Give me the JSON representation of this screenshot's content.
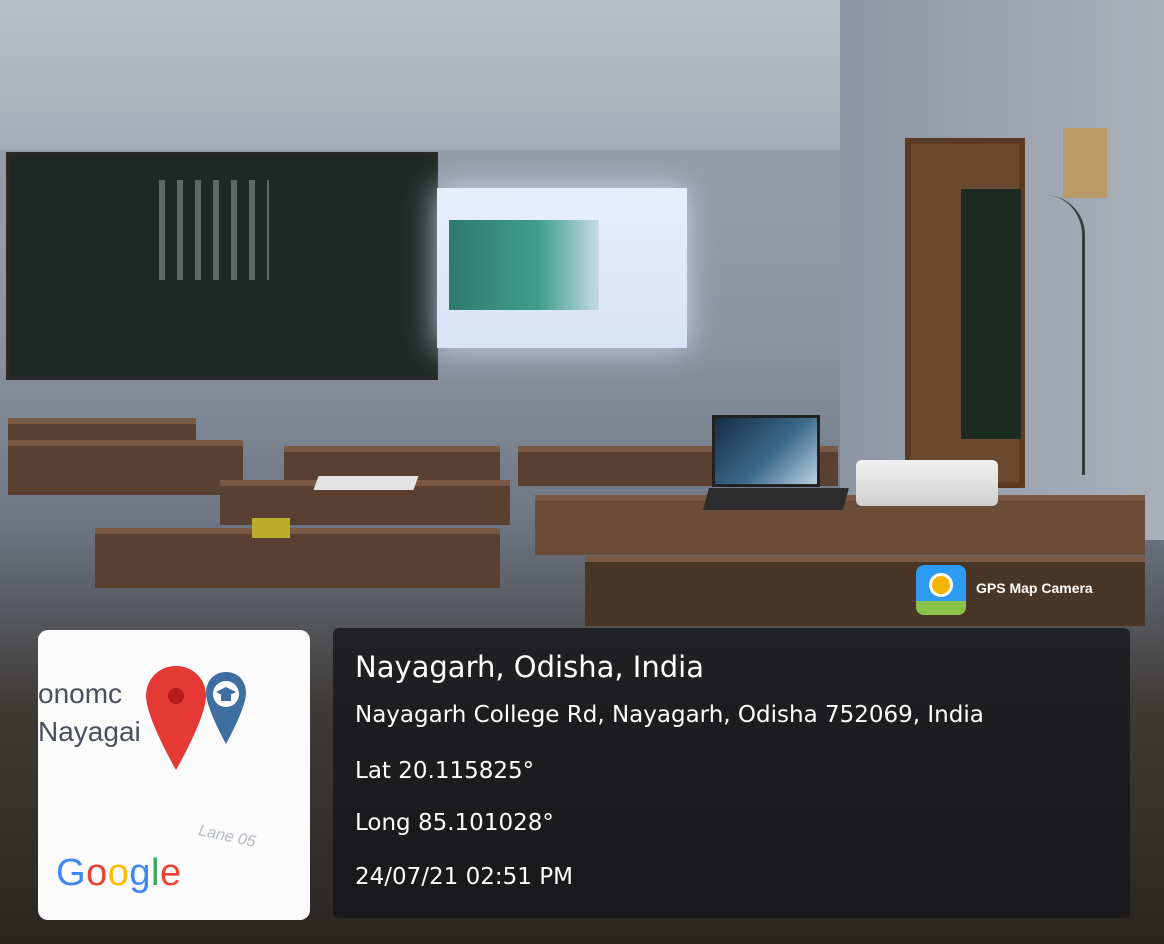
{
  "photo": {
    "scene_icon": "classroom-photo"
  },
  "watermark": {
    "app_name": "GPS Map Camera",
    "app_icon": "gps-map-camera-icon"
  },
  "map_thumbnail": {
    "label_line1": "onomc",
    "label_line2": "Nayagai",
    "lane_label": "Lane 05",
    "provider": "Google",
    "provider_colors": [
      "#4285F4",
      "#EA4335",
      "#FBBC05",
      "#4285F4",
      "#34A853",
      "#EA4335"
    ],
    "pin_color": "#e53935",
    "school_pin_color": "#3f6fa0"
  },
  "location": {
    "title": "Nayagarh, Odisha, India",
    "address": "Nayagarh College Rd, Nayagarh, Odisha 752069, India",
    "latitude": "Lat 20.115825°",
    "longitude": "Long 85.101028°",
    "datetime": "24/07/21 02:51 PM"
  }
}
